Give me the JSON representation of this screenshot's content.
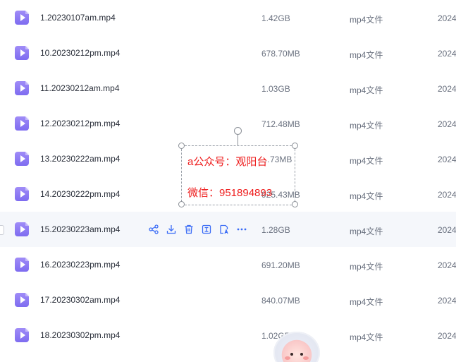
{
  "files": [
    {
      "name": "1.20230107am.mp4",
      "size": "1.42GB",
      "type": "mp4文件",
      "date": "2024"
    },
    {
      "name": "10.20230212pm.mp4",
      "size": "678.70MB",
      "type": "mp4文件",
      "date": "2024"
    },
    {
      "name": "11.20230212am.mp4",
      "size": "1.03GB",
      "type": "mp4文件",
      "date": "2024"
    },
    {
      "name": "12.20230212pm.mp4",
      "size": "712.48MB",
      "type": "mp4文件",
      "date": "2024"
    },
    {
      "name": "13.20230222am.mp4",
      "size": "…73MB",
      "type": "mp4文件",
      "date": "2024"
    },
    {
      "name": "14.20230222pm.mp4",
      "size": "925.43MB",
      "type": "mp4文件",
      "date": "2024"
    },
    {
      "name": "15.20230223am.mp4",
      "size": "1.28GB",
      "type": "mp4文件",
      "date": "2024"
    },
    {
      "name": "16.20230223pm.mp4",
      "size": "691.20MB",
      "type": "mp4文件",
      "date": "2024"
    },
    {
      "name": "17.20230302am.mp4",
      "size": "840.07MB",
      "type": "mp4文件",
      "date": "2024"
    },
    {
      "name": "18.20230302pm.mp4",
      "size": "1.02GB",
      "type": "mp4文件",
      "date": "2024"
    }
  ],
  "hovered_row_actions": [
    "share-icon",
    "download-icon",
    "delete-icon",
    "extract-icon",
    "translate-icon",
    "more-icon"
  ],
  "watermark": {
    "line1": "a公众号：观阳台",
    "line2": "微信：951894893"
  },
  "colors": {
    "accent": "#3b6cf6",
    "file_icon": "#8b78f3",
    "watermark_text": "#ee1c1c",
    "hover_row": "#f5f7fb"
  }
}
